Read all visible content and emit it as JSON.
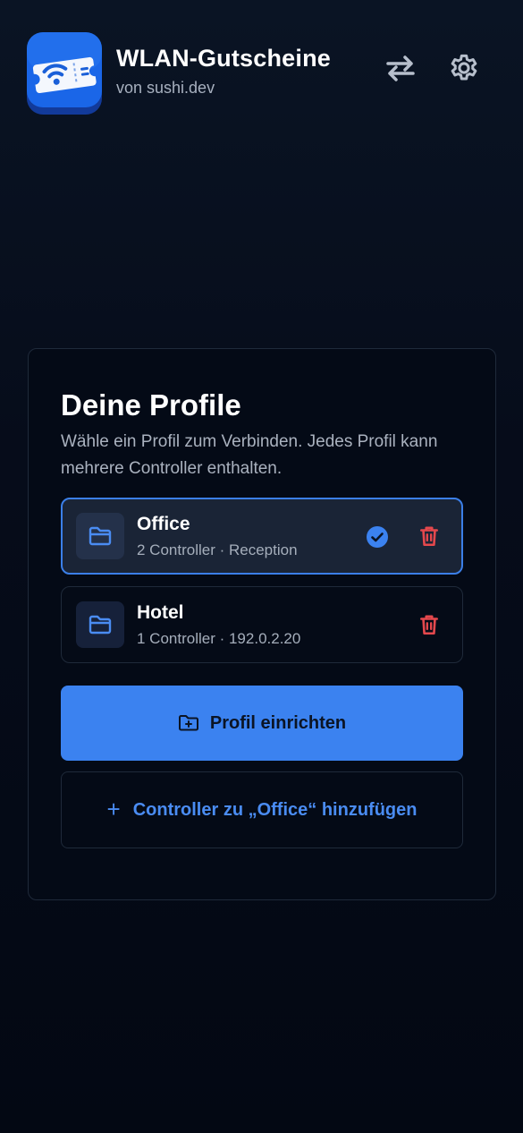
{
  "app": {
    "title": "WLAN-Gutscheine",
    "subtitle": "von sushi.dev",
    "icon": "wifi-ticket-icon"
  },
  "header": {
    "switch_icon": "swap-arrows-icon",
    "settings_icon": "gear-icon"
  },
  "profiles_card": {
    "title": "Deine Profile",
    "description": "Wähle ein Profil zum Verbinden. Jedes Profil kann mehrere Controller enthalten.",
    "profiles": [
      {
        "name": "Office",
        "meta": "2 Controller · Reception",
        "selected": true,
        "icon": "folder-icon"
      },
      {
        "name": "Hotel",
        "meta": "1 Controller · 192.0.2.20",
        "selected": false,
        "icon": "folder-icon"
      }
    ],
    "setup_button": "Profil einrichten",
    "add_controller_button": "Controller zu „Office“ hinzufügen",
    "add_controller_icon": "+"
  },
  "colors": {
    "accent": "#3b82f0",
    "danger": "#e5484d",
    "background": "#050b18"
  }
}
